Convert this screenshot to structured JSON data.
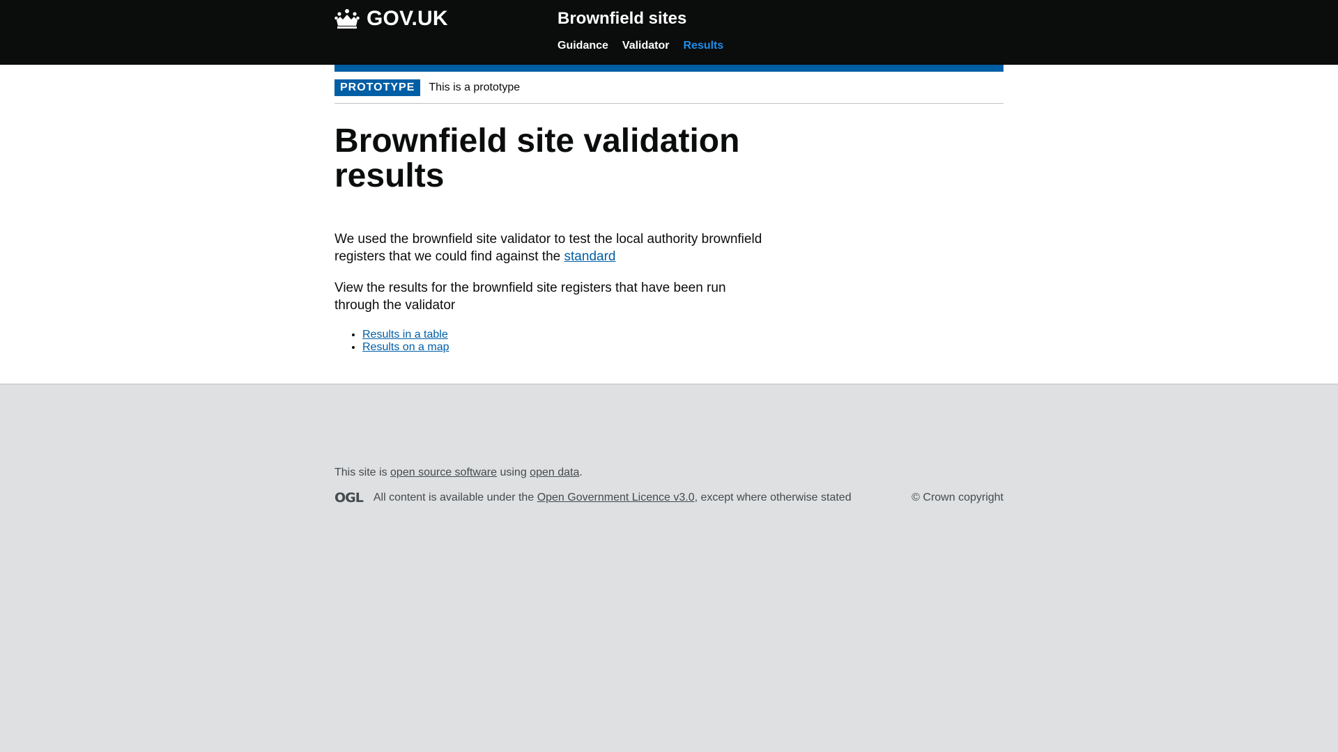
{
  "header": {
    "logo_text": "GOV.UK",
    "service_name": "Brownfield sites",
    "nav": [
      {
        "label": "Guidance",
        "active": false
      },
      {
        "label": "Validator",
        "active": false
      },
      {
        "label": "Results",
        "active": true
      }
    ]
  },
  "phase_banner": {
    "tag": "PROTOTYPE",
    "text": "This is a prototype"
  },
  "main": {
    "title": "Brownfield site validation results",
    "intro_text": "We used the brownfield site validator to test the local authority brownfield registers that we could find against the",
    "intro_link": "standard",
    "view_text": "View the results for the brownfield site registers that have been run through the validator",
    "links": [
      {
        "label": "Results in a table"
      },
      {
        "label": "Results on a map"
      }
    ]
  },
  "footer": {
    "source_prefix": "This site is",
    "source_link": "open source software",
    "source_middle": "using",
    "data_link": "open data",
    "source_suffix": ".",
    "ogl_logo": "OGL",
    "licence_prefix": "All content is available under the",
    "licence_link": "Open Government Licence v3.0",
    "licence_suffix": ", except where otherwise stated",
    "copyright": "© Crown copyright"
  },
  "colors": {
    "header_bg": "#0b0c0c",
    "brand_blue": "#005ea5",
    "nav_active": "#1d8feb",
    "footer_bg": "#dee0e2"
  }
}
